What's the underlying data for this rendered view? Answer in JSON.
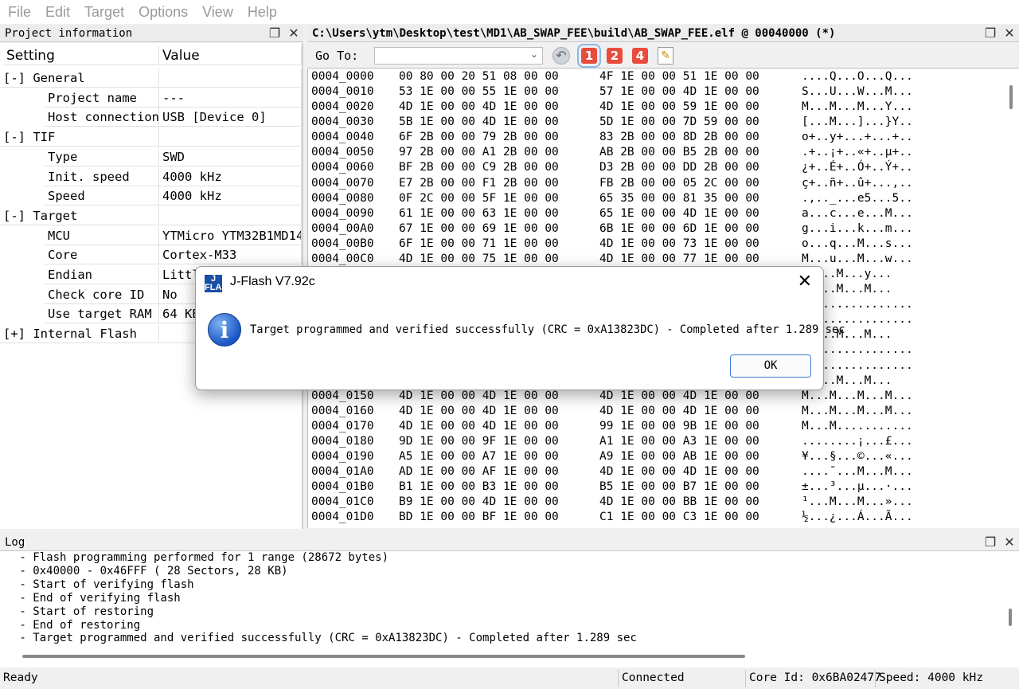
{
  "menu": [
    "File",
    "Edit",
    "Target",
    "Options",
    "View",
    "Help"
  ],
  "project_panel": {
    "title": "Project information",
    "headers": {
      "setting": "Setting",
      "value": "Value"
    },
    "rows": [
      {
        "setting": "[-] General",
        "value": "",
        "indent": 0
      },
      {
        "setting": "Project name",
        "value": "---",
        "indent": 1
      },
      {
        "setting": "Host connection",
        "value": "USB [Device 0]",
        "indent": 1
      },
      {
        "setting": "[-] TIF",
        "value": "",
        "indent": 0
      },
      {
        "setting": "Type",
        "value": "SWD",
        "indent": 1
      },
      {
        "setting": "Init. speed",
        "value": "4000 kHz",
        "indent": 1
      },
      {
        "setting": "Speed",
        "value": "4000 kHz",
        "indent": 1
      },
      {
        "setting": "[-] Target",
        "value": "",
        "indent": 0
      },
      {
        "setting": "MCU",
        "value": "YTMicro YTM32B1MD14",
        "indent": 1
      },
      {
        "setting": "Core",
        "value": "Cortex-M33",
        "indent": 1
      },
      {
        "setting": "Endian",
        "value": "Littl",
        "indent": 1
      },
      {
        "setting": "Check core ID",
        "value": "No",
        "indent": 1
      },
      {
        "setting": "Use target RAM",
        "value": "64 KB",
        "indent": 1
      },
      {
        "setting": "[+] Internal Flash",
        "value": "",
        "indent": 0
      }
    ]
  },
  "hex_panel": {
    "title": "C:\\Users\\ytm\\Desktop\\test\\MD1\\AB_SWAP_FEE\\build\\AB_SWAP_FEE.elf @ 00040000 (*)",
    "goto_label": "Go To:",
    "goto_value": "",
    "toolbar_buttons": [
      "1",
      "2",
      "4"
    ],
    "rows": [
      {
        "addr": "0004_0000",
        "b1": "00 80 00 20 51 08 00 00",
        "b2": "4F 1E 00 00 51 1E 00 00",
        "ascii": "....Q...O...Q..."
      },
      {
        "addr": "0004_0010",
        "b1": "53 1E 00 00 55 1E 00 00",
        "b2": "57 1E 00 00 4D 1E 00 00",
        "ascii": "S...U...W...M..."
      },
      {
        "addr": "0004_0020",
        "b1": "4D 1E 00 00 4D 1E 00 00",
        "b2": "4D 1E 00 00 59 1E 00 00",
        "ascii": "M...M...M...Y..."
      },
      {
        "addr": "0004_0030",
        "b1": "5B 1E 00 00 4D 1E 00 00",
        "b2": "5D 1E 00 00 7D 59 00 00",
        "ascii": "[...M...]...}Y.."
      },
      {
        "addr": "0004_0040",
        "b1": "6F 2B 00 00 79 2B 00 00",
        "b2": "83 2B 00 00 8D 2B 00 00",
        "ascii": "o+..y+...+...+.."
      },
      {
        "addr": "0004_0050",
        "b1": "97 2B 00 00 A1 2B 00 00",
        "b2": "AB 2B 00 00 B5 2B 00 00",
        "ascii": ".+..¡+..«+..µ+.."
      },
      {
        "addr": "0004_0060",
        "b1": "BF 2B 00 00 C9 2B 00 00",
        "b2": "D3 2B 00 00 DD 2B 00 00",
        "ascii": "¿+..É+..Ó+..Ý+.."
      },
      {
        "addr": "0004_0070",
        "b1": "E7 2B 00 00 F1 2B 00 00",
        "b2": "FB 2B 00 00 05 2C 00 00",
        "ascii": "ç+..ñ+..û+...,.."
      },
      {
        "addr": "0004_0080",
        "b1": "0F 2C 00 00 5F 1E 00 00",
        "b2": "65 35 00 00 81 35 00 00",
        "ascii": ".,.._...e5...5.."
      },
      {
        "addr": "0004_0090",
        "b1": "61 1E 00 00 63 1E 00 00",
        "b2": "65 1E 00 00 4D 1E 00 00",
        "ascii": "a...c...e...M..."
      },
      {
        "addr": "0004_00A0",
        "b1": "67 1E 00 00 69 1E 00 00",
        "b2": "6B 1E 00 00 6D 1E 00 00",
        "ascii": "g...i...k...m..."
      },
      {
        "addr": "0004_00B0",
        "b1": "6F 1E 00 00 71 1E 00 00",
        "b2": "4D 1E 00 00 73 1E 00 00",
        "ascii": "o...q...M...s..."
      },
      {
        "addr": "0004_00C0",
        "b1": "4D 1E 00 00 75 1E 00 00",
        "b2": "4D 1E 00 00 77 1E 00 00",
        "ascii": "M...u...M...w..."
      },
      {
        "addr": "",
        "b1": "",
        "b2": "",
        "ascii": ".M...M...y..."
      },
      {
        "addr": "",
        "b1": "",
        "b2": "",
        "ascii": ".{...M...M..."
      },
      {
        "addr": "",
        "b1": "",
        "b2": "",
        "ascii": "................"
      },
      {
        "addr": "",
        "b1": "",
        "b2": "",
        "ascii": "................"
      },
      {
        "addr": "",
        "b1": "",
        "b2": "",
        "ascii": ".M...M...M..."
      },
      {
        "addr": "",
        "b1": "",
        "b2": "",
        "ascii": "................"
      },
      {
        "addr": "",
        "b1": "",
        "b2": "",
        "ascii": "................"
      },
      {
        "addr": "",
        "b1": "",
        "b2": "",
        "ascii": ".M...M...M..."
      },
      {
        "addr": "0004_0150",
        "b1": "4D 1E 00 00 4D 1E 00 00",
        "b2": "4D 1E 00 00 4D 1E 00 00",
        "ascii": "M...M...M...M..."
      },
      {
        "addr": "0004_0160",
        "b1": "4D 1E 00 00 4D 1E 00 00",
        "b2": "4D 1E 00 00 4D 1E 00 00",
        "ascii": "M...M...M...M..."
      },
      {
        "addr": "0004_0170",
        "b1": "4D 1E 00 00 4D 1E 00 00",
        "b2": "99 1E 00 00 9B 1E 00 00",
        "ascii": "M...M..........."
      },
      {
        "addr": "0004_0180",
        "b1": "9D 1E 00 00 9F 1E 00 00",
        "b2": "A1 1E 00 00 A3 1E 00 00",
        "ascii": "........¡...£..."
      },
      {
        "addr": "0004_0190",
        "b1": "A5 1E 00 00 A7 1E 00 00",
        "b2": "A9 1E 00 00 AB 1E 00 00",
        "ascii": "¥...§...©...«..."
      },
      {
        "addr": "0004_01A0",
        "b1": "AD 1E 00 00 AF 1E 00 00",
        "b2": "4D 1E 00 00 4D 1E 00 00",
        "ascii": "....¯...M...M..."
      },
      {
        "addr": "0004_01B0",
        "b1": "B1 1E 00 00 B3 1E 00 00",
        "b2": "B5 1E 00 00 B7 1E 00 00",
        "ascii": "±...³...µ...·..."
      },
      {
        "addr": "0004_01C0",
        "b1": "B9 1E 00 00 4D 1E 00 00",
        "b2": "4D 1E 00 00 BB 1E 00 00",
        "ascii": "¹...M...M...»..."
      },
      {
        "addr": "0004_01D0",
        "b1": "BD 1E 00 00 BF 1E 00 00",
        "b2": "C1 1E 00 00 C3 1E 00 00",
        "ascii": "½...¿...Á...Ã..."
      }
    ]
  },
  "log": {
    "title": "Log",
    "lines": [
      " - Flash programming performed for 1 range (28672 bytes)",
      " - 0x40000 - 0x46FFF ( 28 Sectors, 28 KB)",
      " - Start of verifying flash",
      " - End of verifying flash",
      " - Start of restoring",
      " - End of restoring",
      " - Target programmed and verified successfully (CRC = 0xA13823DC) - Completed after 1.289 sec"
    ]
  },
  "statusbar": {
    "ready": "Ready",
    "connection": "Connected",
    "core_id": "Core Id: 0x6BA02477",
    "speed": "Speed: 4000 kHz"
  },
  "dialog": {
    "logo": "J FLASH",
    "title": "J-Flash V7.92c",
    "message": "Target programmed and verified successfully (CRC = 0xA13823DC) - Completed after 1.289 sec",
    "ok_label": "OK",
    "icon": "info-icon"
  },
  "icons": {
    "restore": "restore-window-icon",
    "close": "close-icon",
    "back": "back-arrow-icon",
    "edit": "edit-notes-icon"
  }
}
